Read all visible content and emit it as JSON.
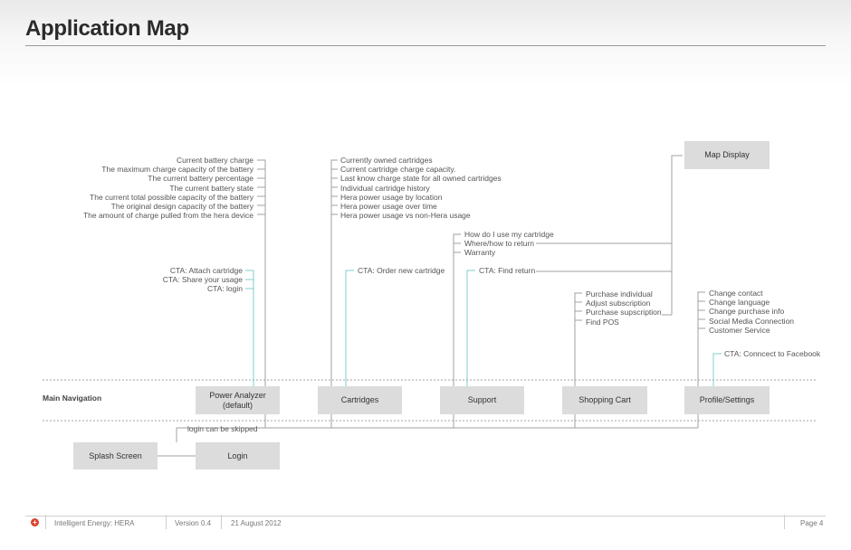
{
  "header": {
    "title": "Application Map"
  },
  "nav_label": "Main Navigation",
  "nodes": {
    "map_display": "Map Display",
    "power_analyzer": "Power Analyzer (default)",
    "cartridges": "Cartridges",
    "support": "Support",
    "shopping_cart": "Shopping Cart",
    "profile_settings": "Profile/Settings",
    "splash_screen": "Splash Screen",
    "login": "Login"
  },
  "login_skip_note": "login can be skipped",
  "power": {
    "info": [
      "Current battery charge",
      "The maximum charge capacity of the battery",
      "The current battery percentage",
      "The current battery state",
      "The current total possible capacity of the battery",
      "The original design capacity of the battery",
      "The amount of charge pulled from the hera device"
    ],
    "cta": [
      "CTA: Attach cartridge",
      "CTA: Share your usage",
      "CTA: login"
    ]
  },
  "cartridges": {
    "info": [
      "Currently owned cartridges",
      "Current cartridge charge capacity.",
      "Last know charge state for all owned cartridges",
      "Individual cartridge history",
      "Hera power usage by location",
      "Hera power usage over time",
      "Hera power usage vs non-Hera usage"
    ],
    "cta": "CTA: Order new cartridge"
  },
  "support": {
    "info": [
      "How do I use my cartridge",
      "Where/how to return",
      "Warranty"
    ],
    "cta": "CTA: Find return"
  },
  "shopping": {
    "info": [
      "Purchase individual",
      "Adjust subscription",
      "Purchase supscription",
      "Find POS"
    ]
  },
  "profile": {
    "info": [
      "Change contact",
      "Change language",
      "Change purchase info",
      "Social Media Connection",
      "Customer Service"
    ],
    "cta": "CTA: Conncect to Facebook"
  },
  "footer": {
    "product": "Intelligent Energy: HERA",
    "version": "Version 0.4",
    "date": "21 August 2012",
    "page": "Page  4"
  },
  "colors": {
    "node_fill": "#dcdcdc",
    "line": "#9a9a9a",
    "cta_line": "#7fcfcf",
    "logo": "#d9432f"
  }
}
